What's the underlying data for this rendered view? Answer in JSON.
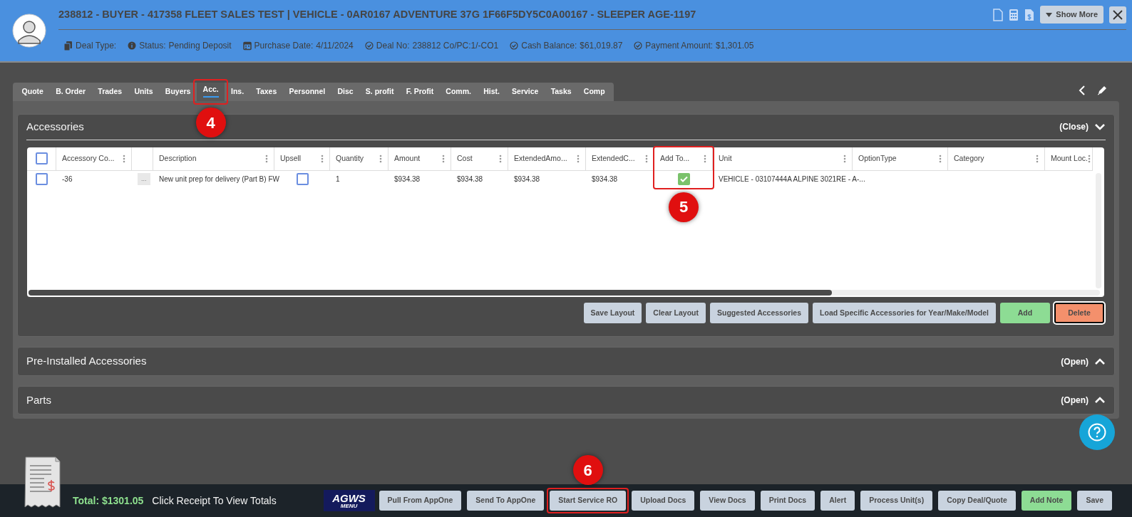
{
  "header": {
    "title": "238812 - BUYER - 417358 FLEET SALES TEST | VEHICLE - 0AR0167 ADVENTURE 37G 1F66F5DY5C0A00167 - SLEEPER AGE-1197",
    "show_more": "Show More",
    "meta": [
      {
        "kind": "doc",
        "label": "Deal Type:"
      },
      {
        "kind": "info",
        "label": "Status:",
        "value": "Pending Deposit"
      },
      {
        "kind": "calendar",
        "label": "Purchase Date:",
        "value": "4/11/2024"
      },
      {
        "kind": "check",
        "label": "Deal No:",
        "value": "238812  Co/PC:1/-CO1"
      },
      {
        "kind": "check",
        "label": "Cash Balance:",
        "value": "$61,019.87"
      },
      {
        "kind": "check",
        "label": "Payment Amount:",
        "value": "$1,301.05"
      }
    ]
  },
  "tabs": [
    {
      "label": "Quote",
      "selected": false
    },
    {
      "label": "B. Order",
      "selected": false
    },
    {
      "label": "Trades",
      "selected": false
    },
    {
      "label": "Units",
      "selected": false
    },
    {
      "label": "Buyers",
      "selected": false
    },
    {
      "label": "Acc.",
      "selected": true,
      "annotation": "4"
    },
    {
      "label": "Ins.",
      "selected": false
    },
    {
      "label": "Taxes",
      "selected": false
    },
    {
      "label": "Personnel",
      "selected": false
    },
    {
      "label": "Disc",
      "selected": false
    },
    {
      "label": "S. profit",
      "selected": false
    },
    {
      "label": "F. Profit",
      "selected": false
    },
    {
      "label": "Comm.",
      "selected": false
    },
    {
      "label": "Hist.",
      "selected": false
    },
    {
      "label": "Service",
      "selected": false
    },
    {
      "label": "Tasks",
      "selected": false
    },
    {
      "label": "Comp",
      "selected": false
    }
  ],
  "accessories": {
    "title": "Accessories",
    "toggle": "(Close)",
    "expanded": true,
    "columns": [
      {
        "kind": "select",
        "checked": false
      },
      {
        "kind": "text",
        "label": "Accessory Co..."
      },
      {
        "kind": "more"
      },
      {
        "kind": "text",
        "label": "Description"
      },
      {
        "kind": "check",
        "label": "Upsell"
      },
      {
        "kind": "text",
        "label": "Quantity"
      },
      {
        "kind": "text",
        "label": "Amount"
      },
      {
        "kind": "text",
        "label": "Cost"
      },
      {
        "kind": "text",
        "label": "ExtendedAmo..."
      },
      {
        "kind": "text",
        "label": "ExtendedC..."
      },
      {
        "kind": "check",
        "label": "Add To...",
        "annotation": "5"
      },
      {
        "kind": "text",
        "label": "Unit"
      },
      {
        "kind": "text",
        "label": "OptionType"
      },
      {
        "kind": "text",
        "label": "Category"
      },
      {
        "kind": "text",
        "label": "Mount Loc."
      }
    ],
    "rows": [
      {
        "selected": false,
        "cells": [
          "",
          "-36",
          "...",
          "New unit prep for delivery (Part B) FW",
          false,
          "1",
          "$934.38",
          "$934.38",
          "$934.38",
          "$934.38",
          true,
          "VEHICLE - 03107444A ALPINE 3021RE - A-...",
          "",
          "",
          ""
        ]
      }
    ],
    "buttons": [
      {
        "kind": "default",
        "label": "Save Layout"
      },
      {
        "kind": "default",
        "label": "Clear Layout"
      },
      {
        "kind": "default",
        "label": "Suggested Accessories"
      },
      {
        "kind": "default",
        "label": "Load Specific Accessories for Year/Make/Model"
      },
      {
        "kind": "add",
        "label": "Add"
      },
      {
        "kind": "delete",
        "label": "Delete"
      }
    ]
  },
  "sections": [
    {
      "title": "Pre-Installed Accessories",
      "toggle": "(Open)",
      "expanded": false
    },
    {
      "title": "Parts",
      "toggle": "(Open)",
      "expanded": false
    }
  ],
  "footer": {
    "total": "Total: $1301.05",
    "hint": "Click Receipt To View Totals",
    "logo": "AGWS",
    "logo_sub": "MENU",
    "buttons": [
      {
        "kind": "default",
        "label": "Pull From AppOne"
      },
      {
        "kind": "default",
        "label": "Send To AppOne"
      },
      {
        "kind": "default",
        "label": "Start Service RO",
        "annotation": "6"
      },
      {
        "kind": "default",
        "label": "Upload Docs"
      },
      {
        "kind": "default",
        "label": "View Docs"
      },
      {
        "kind": "default",
        "label": "Print Docs"
      },
      {
        "kind": "default",
        "label": "Alert"
      },
      {
        "kind": "default",
        "label": "Process Unit(s)"
      },
      {
        "kind": "default",
        "label": "Copy Deal/Quote"
      },
      {
        "kind": "add",
        "label": "Add Note"
      },
      {
        "kind": "default",
        "label": "Save"
      }
    ]
  }
}
